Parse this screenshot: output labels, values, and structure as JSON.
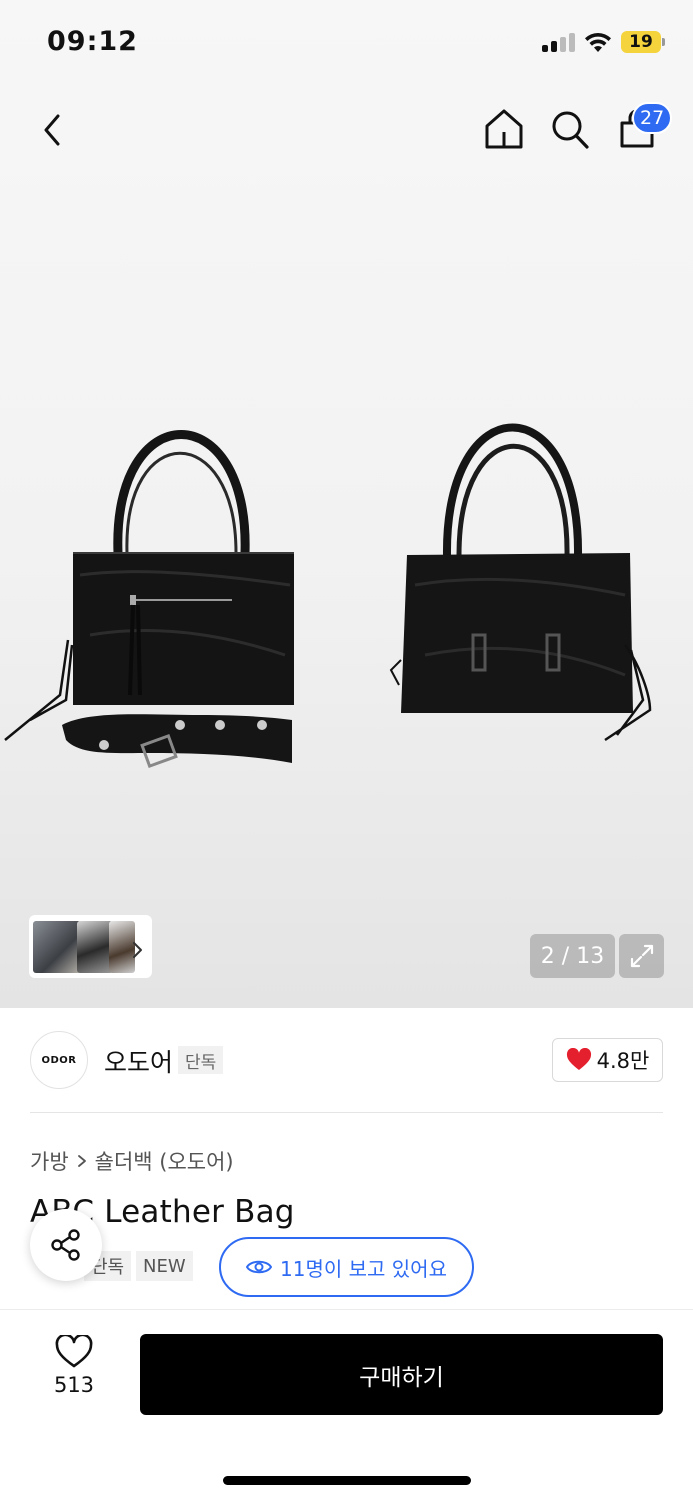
{
  "status_bar": {
    "time": "09:12",
    "battery": "19"
  },
  "nav": {
    "back_icon": "chevron-left-icon",
    "home_icon": "home-icon",
    "search_icon": "search-icon",
    "cart_icon": "shopping-bag-icon",
    "cart_count": "27"
  },
  "gallery": {
    "current_page": "2 / 13",
    "thumbnail_count": 3,
    "expand_icon": "expand-icon"
  },
  "brand": {
    "logo_text": "ODOR",
    "name": "오도어",
    "badge": "단독",
    "like_count": "4.8만",
    "like_icon": "heart-filled-icon"
  },
  "product": {
    "breadcrumb": [
      "가방",
      "숄더백 (오도어)"
    ],
    "title": "ABC Leather Bag",
    "tags": [
      "단독",
      "NEW"
    ],
    "viewers_text": "11명이 보고 있어요",
    "viewers_icon": "eye-icon"
  },
  "bottom_bar": {
    "wish_icon": "heart-outline-icon",
    "wish_count": "513",
    "buy_label": "구매하기"
  },
  "colors": {
    "accent_blue": "#2f6bf2",
    "heart_red": "#e5202e",
    "buy_button": "#000000",
    "battery_yellow": "#f4d33c"
  }
}
